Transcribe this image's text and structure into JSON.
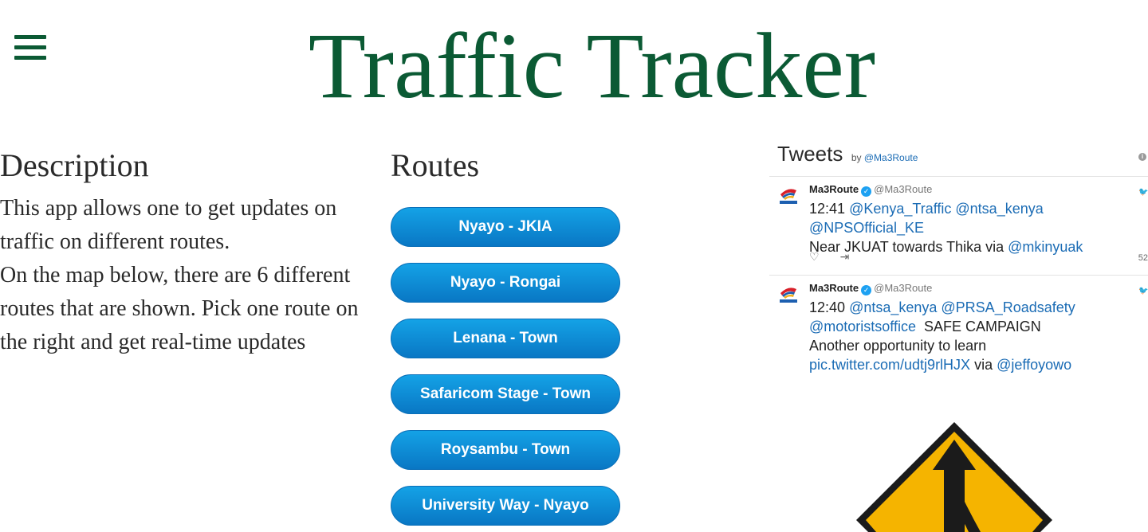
{
  "header": {
    "title": "Traffic Tracker",
    "menu_icon": "hamburger-menu-icon",
    "title_color": "#0b5a34"
  },
  "description": {
    "heading": "Description",
    "lines": [
      "This app allows one to get updates on traffic on different routes.",
      "On the map below, there are 6 different routes that are shown. Pick one route on",
      "the right and get real-time updates"
    ]
  },
  "routes": {
    "heading": "Routes",
    "buttons": [
      "Nyayo - JKIA",
      "Nyayo - Rongai",
      "Lenana - Town",
      "Safaricom Stage - Town",
      "Roysambu - Town",
      "University Way - Nyayo"
    ],
    "button_color": "#0a86d4"
  },
  "tweets": {
    "title": "Tweets",
    "by_prefix": "by",
    "by_handle": "@Ma3Route",
    "items": [
      {
        "author": "Ma3Route",
        "handle": "@Ma3Route",
        "time": "12:41",
        "line1_mentions": "@Kenya_Traffic @ntsa_kenya @NPSOfficial_KE",
        "line2_text": "Near JKUAT towards Thika via",
        "line2_mention": "@mkinyuak",
        "like_count": "52"
      },
      {
        "author": "Ma3Route",
        "handle": "@Ma3Route",
        "time": "12:40",
        "line1_mentions": "@ntsa_kenya @PRSA_Roadsafety",
        "line2_mention": "@motoristsoffice",
        "line2_text": "SAFE CAMPAIGN",
        "line3_text": "Another opportunity to learn",
        "line4_link": "pic.twitter.com/udtj9rlHJX",
        "line4_via": "via",
        "line4_mention": "@jeffoyowo"
      }
    ]
  },
  "image": {
    "icon": "merge-traffic-sign-icon",
    "sign_color": "#f5b400"
  }
}
